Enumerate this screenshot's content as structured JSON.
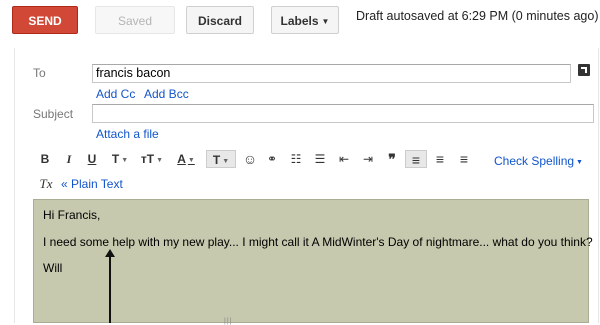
{
  "toolbar": {
    "send_label": "SEND",
    "saved_label": "Saved",
    "discard_label": "Discard",
    "labels_label": "Labels",
    "status": "Draft autosaved at 6:29 PM (0 minutes ago)"
  },
  "compose": {
    "to_label": "To",
    "to_value": "francis bacon",
    "add_cc": "Add Cc",
    "add_bcc": "Add Bcc",
    "subject_label": "Subject",
    "subject_value": "",
    "attach_label": "Attach a file"
  },
  "format": {
    "bold": "B",
    "italic": "I",
    "underline": "U",
    "font": "T",
    "size": "тT",
    "text_color": "A",
    "bg_color": "T",
    "emoji": "☺",
    "link": "⚭",
    "numbered_list": "☷",
    "bullet_list": "☰",
    "indent_less": "⇤",
    "indent_more": "⇥",
    "quote": "❞",
    "align_left": "≡",
    "align_center": "≡",
    "align_right": "≡",
    "check_spelling": "Check Spelling",
    "remove_formatting": "Tx",
    "plain_text": "« Plain Text"
  },
  "message": {
    "line1": "Hi Francis,",
    "line2": "I need some help with my new play... I might call it A MidWinter's Day of nightmare... what do you think?",
    "line3": "Will"
  },
  "colors": {
    "send": "#d14836",
    "link": "#1155cc",
    "body_bg": "#c6c9ad"
  }
}
